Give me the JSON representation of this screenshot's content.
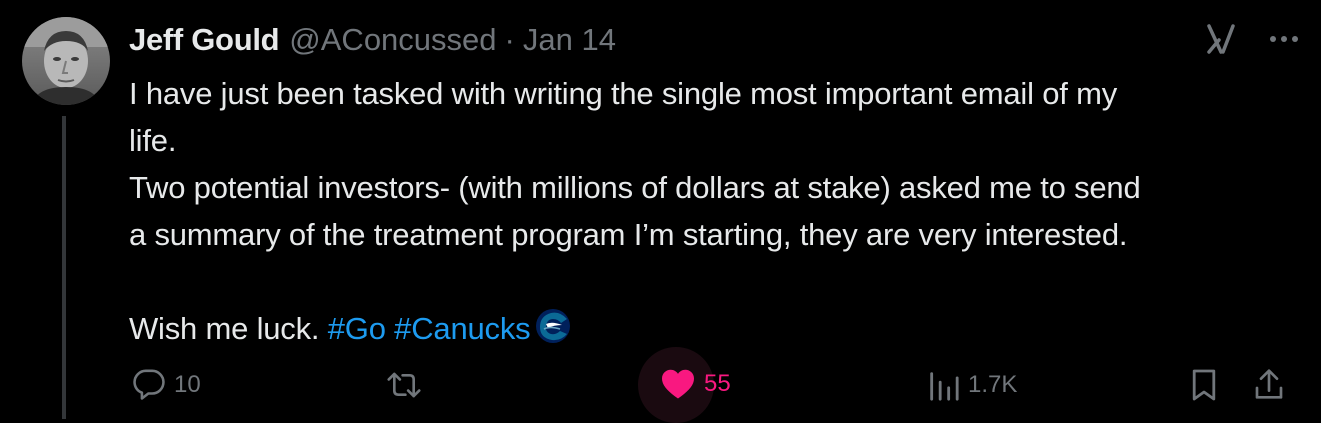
{
  "tweet": {
    "author": {
      "display_name": "Jeff Gould",
      "handle": "@AConcussed",
      "avatar": "avatar-photo"
    },
    "separator": "·",
    "date": "Jan 14",
    "text_lines": [
      "I have just been tasked with writing the single most important email of my",
      "life.",
      "Two potential investors- (with millions of dollars at stake) asked me to send",
      "a summary of the treatment program I’m starting, they are very interested."
    ],
    "closing_text": "Wish me luck.",
    "hashtags": [
      "#Go",
      "#Canucks"
    ],
    "emoji": "canucks-logo-icon",
    "actions": {
      "replies": "10",
      "retweets": "",
      "likes": "55",
      "views": "1.7K"
    },
    "icons": [
      "grok-icon",
      "more-icon",
      "reply-icon",
      "retweet-icon",
      "heart-icon",
      "views-icon",
      "bookmark-icon",
      "share-icon"
    ],
    "colors": {
      "background": "#000000",
      "text": "#e7e9ea",
      "muted": "#71767b",
      "link": "#1d9bf0",
      "like": "#f91880"
    }
  }
}
